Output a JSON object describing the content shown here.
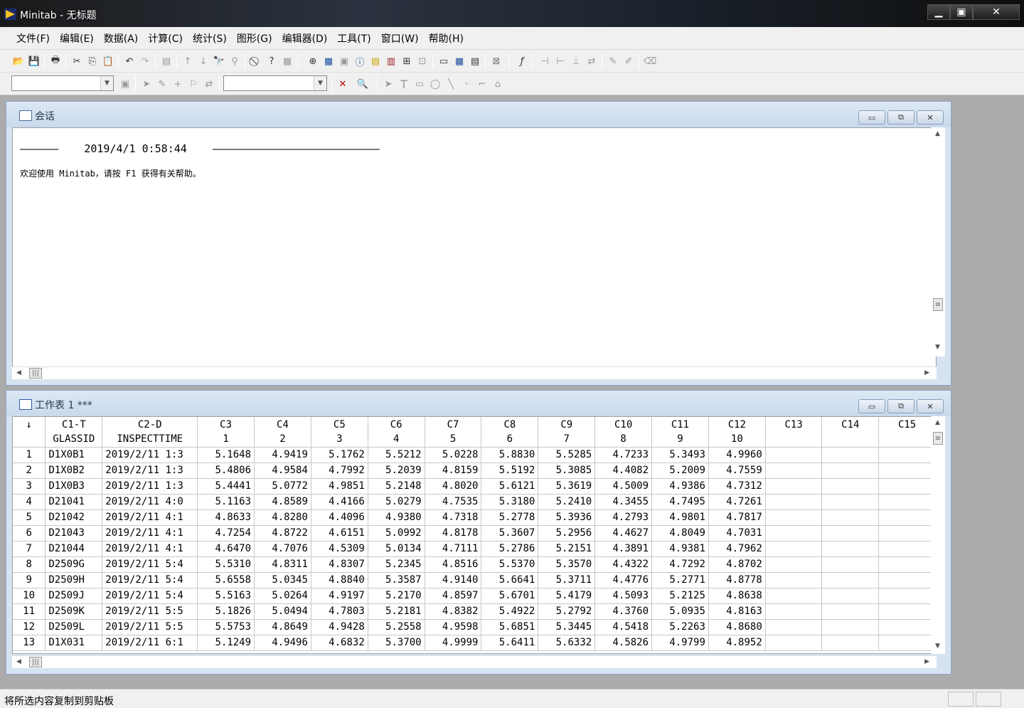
{
  "window": {
    "title": "Minitab - 无标题",
    "min": "▁",
    "max": "▣",
    "close": "✕"
  },
  "menu": [
    "文件(F)",
    "编辑(E)",
    "数据(A)",
    "计算(C)",
    "统计(S)",
    "图形(G)",
    "编辑器(D)",
    "工具(T)",
    "窗口(W)",
    "帮助(H)"
  ],
  "session": {
    "title": "会话",
    "header": "——————    2019/4/1 0:58:44    ——————————————————————————",
    "welcome": "欢迎使用 Minitab，请按 F1 获得有关帮助。"
  },
  "worksheet": {
    "title": "工作表 1 ***",
    "corner": "↓",
    "columns": [
      "C1-T",
      "C2-D",
      "C3",
      "C4",
      "C5",
      "C6",
      "C7",
      "C8",
      "C9",
      "C10",
      "C11",
      "C12",
      "C13",
      "C14",
      "C15"
    ],
    "names": [
      "GLASSID",
      "INSPECTTIME",
      "1",
      "2",
      "3",
      "4",
      "5",
      "6",
      "7",
      "8",
      "9",
      "10",
      "",
      "",
      ""
    ],
    "rows": [
      [
        "1",
        "D1X0B1",
        "2019/2/11 1:3",
        "5.1648",
        "4.9419",
        "5.1762",
        "5.5212",
        "5.0228",
        "5.8830",
        "5.5285",
        "4.7233",
        "5.3493",
        "4.9960"
      ],
      [
        "2",
        "D1X0B2",
        "2019/2/11 1:3",
        "5.4806",
        "4.9584",
        "4.7992",
        "5.2039",
        "4.8159",
        "5.5192",
        "5.3085",
        "4.4082",
        "5.2009",
        "4.7559"
      ],
      [
        "3",
        "D1X0B3",
        "2019/2/11 1:3",
        "5.4441",
        "5.0772",
        "4.9851",
        "5.2148",
        "4.8020",
        "5.6121",
        "5.3619",
        "4.5009",
        "4.9386",
        "4.7312"
      ],
      [
        "4",
        "D21041",
        "2019/2/11 4:0",
        "5.1163",
        "4.8589",
        "4.4166",
        "5.0279",
        "4.7535",
        "5.3180",
        "5.2410",
        "4.3455",
        "4.7495",
        "4.7261"
      ],
      [
        "5",
        "D21042",
        "2019/2/11 4:1",
        "4.8633",
        "4.8280",
        "4.4096",
        "4.9380",
        "4.7318",
        "5.2778",
        "5.3936",
        "4.2793",
        "4.9801",
        "4.7817"
      ],
      [
        "6",
        "D21043",
        "2019/2/11 4:1",
        "4.7254",
        "4.8722",
        "4.6151",
        "5.0992",
        "4.8178",
        "5.3607",
        "5.2956",
        "4.4627",
        "4.8049",
        "4.7031"
      ],
      [
        "7",
        "D21044",
        "2019/2/11 4:1",
        "4.6470",
        "4.7076",
        "4.5309",
        "5.0134",
        "4.7111",
        "5.2786",
        "5.2151",
        "4.3891",
        "4.9381",
        "4.7962"
      ],
      [
        "8",
        "D2509G",
        "2019/2/11 5:4",
        "5.5310",
        "4.8311",
        "4.8307",
        "5.2345",
        "4.8516",
        "5.5370",
        "5.3570",
        "4.4322",
        "4.7292",
        "4.8702"
      ],
      [
        "9",
        "D2509H",
        "2019/2/11 5:4",
        "5.6558",
        "5.0345",
        "4.8840",
        "5.3587",
        "4.9140",
        "5.6641",
        "5.3711",
        "4.4776",
        "5.2771",
        "4.8778"
      ],
      [
        "10",
        "D2509J",
        "2019/2/11 5:4",
        "5.5163",
        "5.0264",
        "4.9197",
        "5.2170",
        "4.8597",
        "5.6701",
        "5.4179",
        "4.5093",
        "5.2125",
        "4.8638"
      ],
      [
        "11",
        "D2509K",
        "2019/2/11 5:5",
        "5.1826",
        "5.0494",
        "4.7803",
        "5.2181",
        "4.8382",
        "5.4922",
        "5.2792",
        "4.3760",
        "5.0935",
        "4.8163"
      ],
      [
        "12",
        "D2509L",
        "2019/2/11 5:5",
        "5.5753",
        "4.8649",
        "4.9428",
        "5.2558",
        "4.9598",
        "5.6851",
        "5.3445",
        "4.5418",
        "5.2263",
        "4.8680"
      ],
      [
        "13",
        "D1X031",
        "2019/2/11 6:1",
        "5.1249",
        "4.9496",
        "4.6832",
        "5.3700",
        "4.9999",
        "5.6411",
        "5.6332",
        "4.5826",
        "4.9799",
        "4.8952"
      ]
    ]
  },
  "status": {
    "text": "将所选内容复制到剪贴板"
  }
}
